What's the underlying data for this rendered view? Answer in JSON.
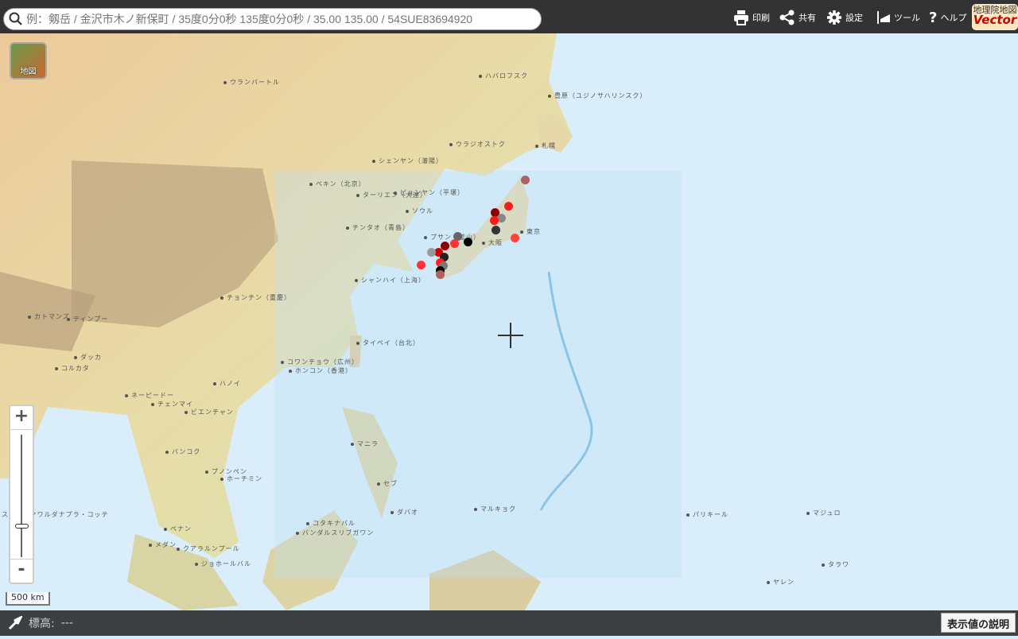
{
  "search": {
    "placeholder": "例：剱岳 / 金沢市木ノ新保町 / 35度0分0秒 135度0分0秒 / 35.00 135.00 / 54SUE83694920"
  },
  "toolbar": {
    "print": "印刷",
    "share": "共有",
    "settings": "設定",
    "tools": "ツール",
    "help": "ヘルプ"
  },
  "logo": {
    "line1": "地理院地図",
    "line2": "Vector"
  },
  "map_button": {
    "label": "地図"
  },
  "zoom": {
    "plus": "+",
    "minus": "-",
    "level_fraction": 0.25
  },
  "scale": {
    "label": "500 km"
  },
  "places": [
    "ウランバートル",
    "ハバロフスク",
    "豊原（ユジノサハリンスク）",
    "ウラジオストク",
    "札幌",
    "シェンヤン（瀋陽）",
    "ペキン（北京）",
    "ターリエン（大連）",
    "ピョンヤン（平壌）",
    "ソウル",
    "チンタオ（青島）",
    "プサン（釜山）",
    "大阪",
    "東京",
    "シャンハイ（上海）",
    "チョンチン（重慶）",
    "カトマンズ",
    "ティンプー",
    "タイペイ（台北）",
    "ダッカ",
    "コルカタ",
    "コワンチョウ（広州）",
    "ホンコン（香港）",
    "ハノイ",
    "ネーピードー",
    "チェンマイ",
    "ビエンチャン",
    "マニラ",
    "バンコク",
    "プノンペン",
    "ホーチミン",
    "セブ",
    "ダバオ",
    "マルキョク",
    "パリキール",
    "マジュロ",
    "コタキナバル",
    "バンダルスリブガワン",
    "ペナン",
    "メダン",
    "クアラルンプール",
    "ジョホールバル",
    "タラワ",
    "ヤレン",
    "スリジャヤワルダナプラ・コッテ"
  ],
  "markers": {
    "colors": {
      "red": "#ff1a1a",
      "darkred": "#8b0000",
      "black": "#000000",
      "gray": "#777777",
      "rose": "#b06060"
    }
  },
  "footer": {
    "elevation_label": "標高:",
    "elevation_value": "---",
    "explain_button": "表示値の説明"
  }
}
